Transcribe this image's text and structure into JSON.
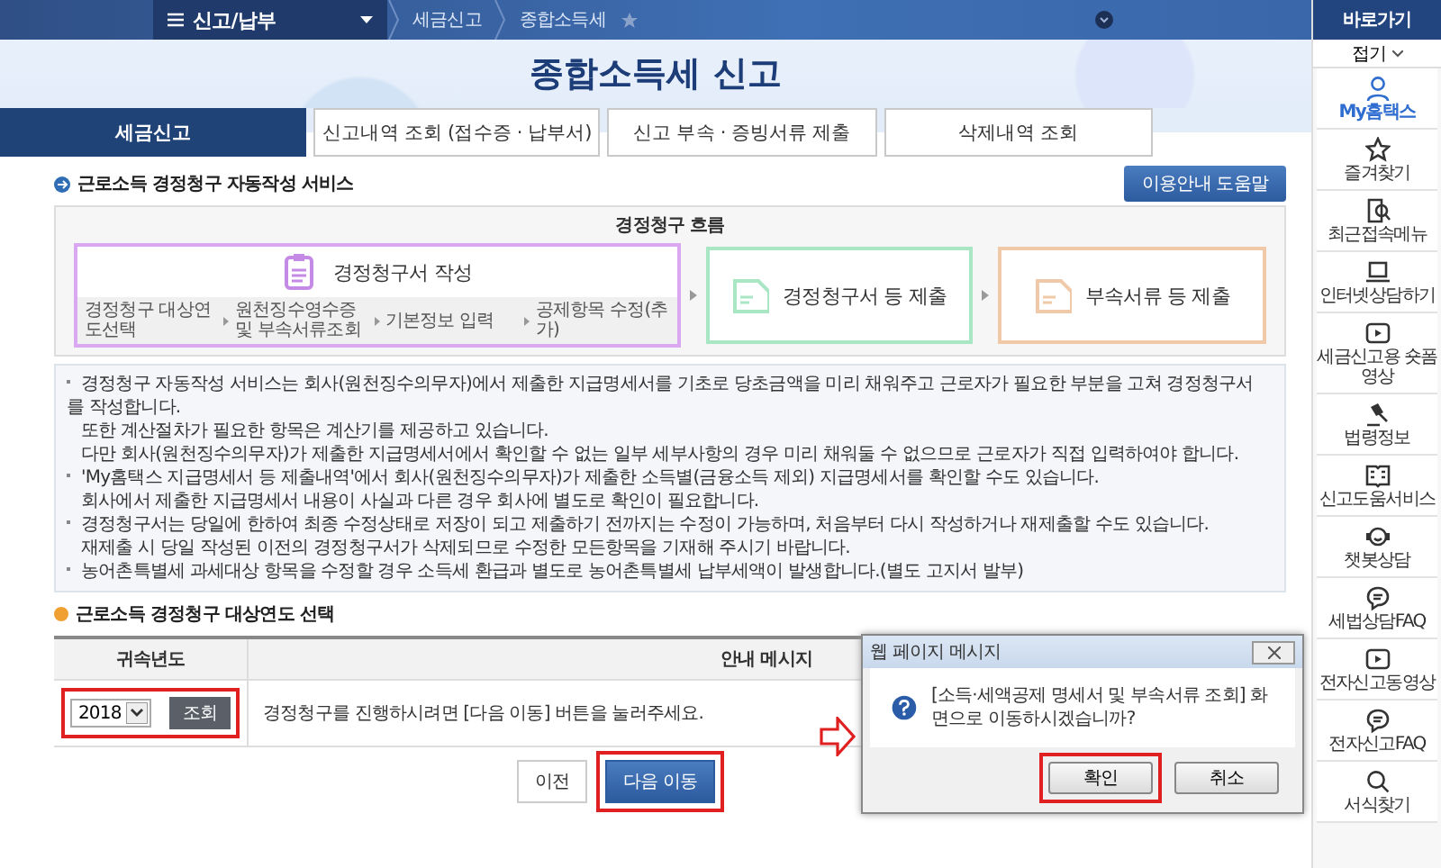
{
  "topbar": {
    "menu": "신고/납부",
    "breadcrumbs": [
      "세금신고",
      "종합소득세"
    ]
  },
  "title": "종합소득세 신고",
  "tabs": [
    {
      "label": "세금신고",
      "selected": true
    },
    {
      "label": "신고내역 조회 (접수증 · 납부서)",
      "selected": false
    },
    {
      "label": "신고 부속 · 증빙서류 제출",
      "selected": false
    },
    {
      "label": "삭제내역 조회",
      "selected": false
    }
  ],
  "service": {
    "heading": "근로소득 경정청구 자동작성 서비스",
    "help_button": "이용안내 도움말",
    "flow": {
      "title": "경정청구 흐름",
      "steps": [
        {
          "label": "경정청구서 작성",
          "color": "#d9a8f0",
          "substeps": [
            "경정청구 대상연도선택",
            "원천징수영수증 및 부속서류조회",
            "기본정보 입력",
            "공제항목 수정(추가)"
          ]
        },
        {
          "label": "경정청구서 등 제출",
          "color": "#a8e6c4"
        },
        {
          "label": "부속서류 등 제출",
          "color": "#efc9a8"
        }
      ]
    },
    "notes": [
      {
        "lines": [
          "경정청구 자동작성 서비스는 회사(원천징수의무자)에서 제출한 지급명세서를 기초로 당초금액을 미리 채워주고 근로자가 필요한 부분을 고쳐 경정청구서를 작성합니다.",
          "또한 계산절차가 필요한 항목은 계산기를 제공하고 있습니다.",
          "다만 회사(원천징수의무자)가 제출한 지급명세서에서 확인할 수 없는 일부 세부사항의 경우 미리 채워둘 수 없으므로 근로자가 직접 입력하여야 합니다."
        ]
      },
      {
        "lines": [
          "'My홈택스 지급명세서 등 제출내역'에서 회사(원천징수의무자)가 제출한 소득별(금융소득 제외) 지급명세서를 확인할 수도 있습니다.",
          "회사에서 제출한 지급명세서 내용이 사실과 다른 경우 회사에 별도로 확인이 필요합니다."
        ]
      },
      {
        "lines": [
          "경정청구서는 당일에 한하여 최종 수정상태로 저장이 되고 제출하기 전까지는 수정이 가능하며, 처음부터 다시 작성하거나 재제출할 수도 있습니다.",
          "재제출 시 당일 작성된 이전의 경정청구서가 삭제되므로 수정한 모든항목을 기재해 주시기 바랍니다."
        ]
      },
      {
        "lines": [
          "농어촌특별세 과세대상 항목을 수정할 경우 소득세 환급과 별도로 농어촌특별세 납부세액이 발생합니다.(별도 고지서 발부)"
        ]
      }
    ]
  },
  "target": {
    "heading": "근로소득 경정청구 대상연도 선택",
    "columns": [
      "귀속년도",
      "안내 메시지"
    ],
    "year": "2018",
    "query_button": "조회",
    "message": "경정청구를 진행하시려면 [다음 이동] 버튼을 눌러주세요.",
    "highlighted": true
  },
  "buttons": [
    {
      "label": "이전",
      "kind": "secondary",
      "highlighted": false
    },
    {
      "label": "다음 이동",
      "kind": "primary",
      "highlighted": true
    }
  ],
  "dialog": {
    "title": "웹 페이지 메시지",
    "message": "[소득·세액공제 명세서 및 부속서류 조회] 화면으로 이동하시겠습니까?",
    "buttons": [
      {
        "label": "확인",
        "highlighted": true
      },
      {
        "label": "취소",
        "highlighted": false
      }
    ]
  },
  "sidebar": {
    "title": "바로가기",
    "collapse": "접기",
    "items": [
      {
        "label": "My홈택스",
        "selected": true
      },
      {
        "label": "즐겨찾기",
        "selected": false
      },
      {
        "label": "최근접속메뉴",
        "selected": false
      },
      {
        "label": "인터넷상담하기",
        "selected": false
      },
      {
        "label": "세금신고용 숏폼영상",
        "selected": false
      },
      {
        "label": "법령정보",
        "selected": false
      },
      {
        "label": "신고도움서비스",
        "selected": false
      },
      {
        "label": "챗봇상담",
        "selected": false
      },
      {
        "label": "세법상담FAQ",
        "selected": false
      },
      {
        "label": "전자신고동영상",
        "selected": false
      },
      {
        "label": "전자신고FAQ",
        "selected": false
      },
      {
        "label": "서식찾기",
        "selected": false
      }
    ]
  }
}
